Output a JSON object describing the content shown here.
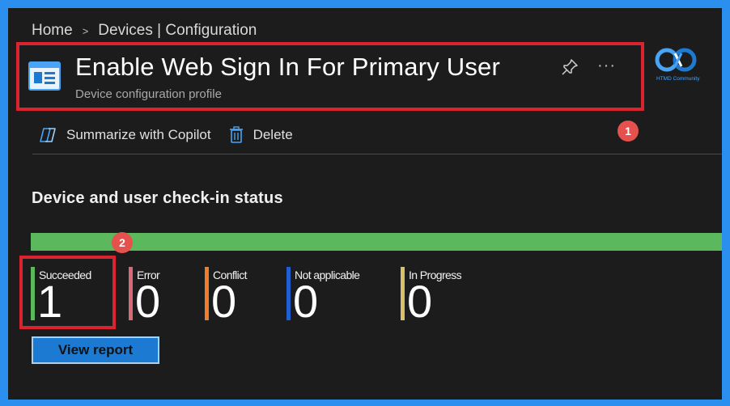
{
  "breadcrumb": {
    "home": "Home",
    "separator": ">",
    "current": "Devices | Configuration"
  },
  "header": {
    "title": "Enable Web Sign In For Primary User",
    "subtitle": "Device configuration profile",
    "more": "···"
  },
  "logo": {
    "text": "HTMD Community"
  },
  "toolbar": {
    "copilot_label": "Summarize with Copilot",
    "delete_label": "Delete"
  },
  "annotations": {
    "badge1": "1",
    "badge2": "2"
  },
  "section": {
    "title": "Device and user check-in status"
  },
  "status": {
    "progress_fraction": 1.0,
    "bar_color": "#5cb85c",
    "items": [
      {
        "label": "Succeeded",
        "value": "1",
        "color": "#5cb85c"
      },
      {
        "label": "Error",
        "value": "0",
        "color": "#d66b77"
      },
      {
        "label": "Conflict",
        "value": "0",
        "color": "#f07c2c"
      },
      {
        "label": "Not applicable",
        "value": "0",
        "color": "#1f5fd0"
      },
      {
        "label": "In Progress",
        "value": "0",
        "color": "#d8c16a"
      }
    ]
  },
  "actions": {
    "view_report": "View report"
  },
  "colors": {
    "background": "#1c1c1c",
    "frame": "#2b8ff0",
    "highlight": "#d9242f",
    "accent": "#1d7ad2"
  }
}
